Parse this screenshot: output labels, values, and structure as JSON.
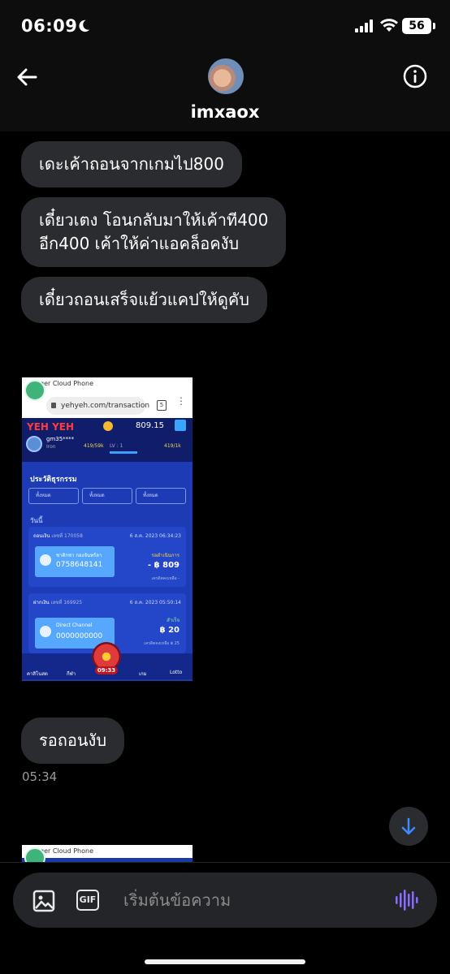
{
  "status_bar": {
    "time": "06:09",
    "battery": "56"
  },
  "header": {
    "username": "imxaox"
  },
  "messages": [
    {
      "text": "เดะเค้าถอนจากเกมไป800"
    },
    {
      "text": "เดี๋ยวเตง โอนกลับมาให้เค้าที400\nอีก400 เค้าให้ค่าแอคล็อคงับ"
    },
    {
      "text": "เดี๋ยวถอนเสร็จแย้วแคปให้ดูคับ"
    },
    {
      "text": "รอถอนงับ"
    }
  ],
  "timestamp": "05:34",
  "shared_screenshot": {
    "app_bar": "ger Cloud Phone",
    "url": "yehyeh.com/transaction",
    "tab_count": "5",
    "logo": "YEH YEH",
    "balance": "809.15",
    "user": "gm35****",
    "user_tier": "Iron",
    "xp_left": "419/59k",
    "level": "LV : 1",
    "xp_right": "419/1k",
    "heading": "ประวัติธุรกรรม",
    "filters": [
      "ทั้งหมด",
      "ทั้งหมด",
      "ทั้งหมด"
    ],
    "today_label": "วันนี้",
    "transactions": [
      {
        "title": "ถอนเงิน",
        "ref": "เลขที่ 170058",
        "date": "6 ส.ค. 2023 06:34:23",
        "bank": "ชาติกชา กองจันทร์ลา",
        "account": "0758648141",
        "status": "รอดำเนินการ",
        "amount": "- ฿ 809",
        "balance_note": "เครดิตคงเหลือ -",
        "status_color": "#ffd24a"
      },
      {
        "title": "ฝากเงิน",
        "ref": "เลขที่ 169925",
        "date": "6 ส.ค. 2023 05:50:14",
        "bank": "Direct Channel",
        "account": "0000000000",
        "status": "สำเร็จ",
        "amount": "฿ 20",
        "balance_note": "เครดิตคงเหลือ ฿ 25",
        "status_color": "#7cf59a"
      }
    ],
    "nav": [
      "คาสิโนสด",
      "กีฬา",
      "เกม",
      "Lotto"
    ],
    "timer": "09:33"
  },
  "composer": {
    "placeholder": "เริ่มต้นข้อความ"
  },
  "colors": {
    "bubble": "#2b2c30",
    "accent": "#3d8bff",
    "voice": "#8b6cff"
  }
}
